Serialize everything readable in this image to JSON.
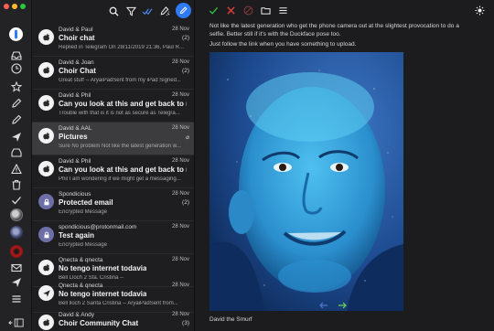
{
  "colors": {
    "accent": "#2f7bf5",
    "close": "#ff5f57",
    "minimize": "#febc2e",
    "maximize": "#28c840",
    "check": "#2fbf3a",
    "cross": "#e04040"
  },
  "rail": {
    "items": [
      "account-logo-icon",
      "inbox-icon",
      "clock-icon",
      "star-icon",
      "pencil-icon",
      "send-icon",
      "archive-icon",
      "warning-icon",
      "trash-icon",
      "check-icon",
      "avatar-1",
      "avatar-2",
      "avatar-3",
      "mail-icon",
      "send-icon-2",
      "menu-icon",
      "sidebar-toggle-icon"
    ]
  },
  "list_toolbar": {
    "icons": [
      "search-icon",
      "filter-icon",
      "mark-read-icon",
      "clean-icon",
      "compose-icon"
    ]
  },
  "messages": [
    {
      "from": "David & Paul",
      "date": "28 Nov",
      "subject": "Choir chat",
      "preview": "Replied in Telegram On 28/11/2019 21:36, Paul R...",
      "count": "(2)"
    },
    {
      "from": "David & Joan",
      "date": "28 Nov",
      "subject": "Choir Chat",
      "preview": "Great stuff -- AryaiPadSent from my iPad Signed...",
      "count": "(2)"
    },
    {
      "from": "David & Phil",
      "date": "28 Nov",
      "subject": "Can you look at this and get back to me",
      "preview": "Trouble with that is it is not as secure as Telegra...",
      "count": ""
    },
    {
      "from": "David & AAL",
      "date": "28 Nov",
      "subject": "Pictures",
      "preview": "Sure No problem Not like the latest generation w...",
      "count": ""
    },
    {
      "from": "David & Phil",
      "date": "28 Nov",
      "subject": "Can you look at this and get back to me",
      "preview": "Phil I am wondering if we might get a messaging...",
      "count": ""
    },
    {
      "from": "Spondicious",
      "date": "28 Nov",
      "subject": "Protected email",
      "preview": "Encrypted Message",
      "count": "(2)"
    },
    {
      "from": "spondicious@protonmail.com",
      "date": "28 Nov",
      "subject": "Test again",
      "preview": "Encrypted Message",
      "count": ""
    },
    {
      "from": "Qnecta & qnecta",
      "date": "28 Nov",
      "subject": "No tengo internet todavia",
      "preview": "Bell Lloch 2 Sta. Cristina --",
      "count": ""
    },
    {
      "from": "Qnecta & qnecta",
      "date": "28 Nov",
      "subject": "No tengo internet todavia",
      "preview": "Bell lloch 2 Santa Cristina -- AryaiPadSent from...",
      "count": ""
    },
    {
      "from": "David & Andy",
      "date": "28 Nov",
      "subject": "Choir Community Chat",
      "preview": "",
      "count": "(3)"
    }
  ],
  "reader_toolbar": {
    "icons": [
      "check-icon",
      "close-icon",
      "spam-icon",
      "folder-icon",
      "menu-icon",
      "settings-icon"
    ]
  },
  "reader": {
    "line1": "Not like the latest generation who get the phone camera out at the slightest provocation to do a",
    "line2": "selfie. Better still if it's with the Duckface pose too.",
    "line3": "Just follow the link when you have something to upload.",
    "caption": "David the Smurf"
  }
}
